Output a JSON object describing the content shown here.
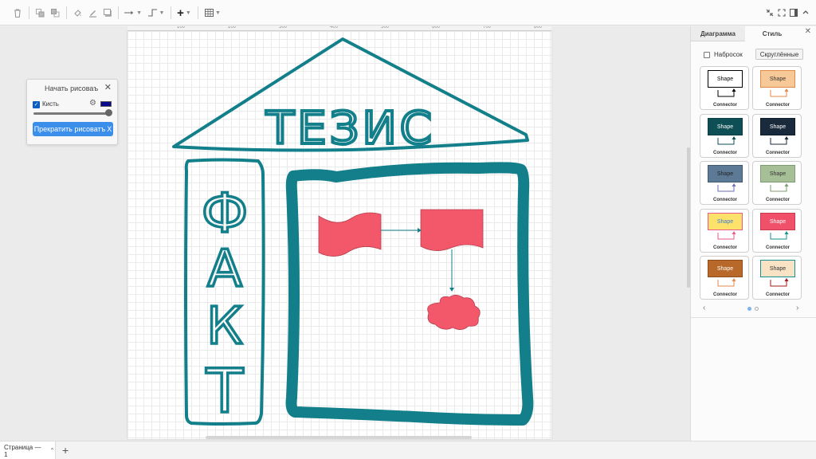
{
  "toolbar": {
    "icons": [
      "delete-icon",
      "to-front-icon",
      "to-back-icon",
      "fill-color-icon",
      "line-color-icon",
      "shadow-icon",
      "connection-icon",
      "waypoints-icon",
      "insert-icon",
      "table-icon",
      "fullscreen-icon",
      "collapse-icon",
      "format-panel-icon",
      "expand-icon"
    ]
  },
  "ruler": [
    "100",
    "200",
    "300",
    "400",
    "500",
    "600",
    "700",
    "800"
  ],
  "freehand": {
    "title": "Начать рисоваъ",
    "close": "✕",
    "brush_label": "Кисть",
    "brush_color": "#0a0a8c",
    "stop_label": "Прекратить рисоватъ",
    "stop_x": "X"
  },
  "drawing": {
    "roof_text": "ТЕЗИС",
    "pillar_text": [
      "Ф",
      "А",
      "К",
      "Т"
    ],
    "stroke_color": "#127f8a",
    "shape_fill": "#f2576a"
  },
  "statusbar": {
    "page_label": "Страница — 1",
    "page_caret": "⌃",
    "add_page": "+"
  },
  "sidebar": {
    "tabs": [
      "Диаграмма",
      "Стиль"
    ],
    "close": "✕",
    "sketch_label": "Набросок",
    "rounded_label": "Скруглённые",
    "styles": [
      {
        "shape": "Shape",
        "connector": "Connector",
        "fill": "#ffffff",
        "stroke": "#000000",
        "text": "#000000",
        "line": "#000000"
      },
      {
        "shape": "Shape",
        "connector": "Connector",
        "fill": "#f7c998",
        "stroke": "#e28a4a",
        "text": "#333333",
        "line": "#e28a4a"
      },
      {
        "shape": "Shape",
        "connector": "Connector",
        "fill": "#0d4f55",
        "stroke": "#0b3d42",
        "text": "#ffffff",
        "line": "#0d4f55"
      },
      {
        "shape": "Shape",
        "connector": "Connector",
        "fill": "#192a3d",
        "stroke": "#0f1a28",
        "text": "#ffffff",
        "line": "#192a3d"
      },
      {
        "shape": "Shape",
        "connector": "Connector",
        "fill": "#5c7a96",
        "stroke": "#40576d",
        "text": "#222222",
        "line": "#6a6fb8"
      },
      {
        "shape": "Shape",
        "connector": "Connector",
        "fill": "#a6bf97",
        "stroke": "#7d9a70",
        "text": "#333333",
        "line": "#7d9a70"
      },
      {
        "shape": "Shape",
        "connector": "Connector",
        "fill": "#fce26b",
        "stroke": "#e75a8c",
        "text": "#3b7ad6",
        "line": "#e75a8c"
      },
      {
        "shape": "Shape",
        "connector": "Connector",
        "fill": "#f0506a",
        "stroke": "#c8384f",
        "text": "#ffffff",
        "line": "#1a8f8f"
      },
      {
        "shape": "Shape",
        "connector": "Connector",
        "fill": "#b8692a",
        "stroke": "#8d4d1c",
        "text": "#ffffff",
        "line": "#e28a4a"
      },
      {
        "shape": "Shape",
        "connector": "Connector",
        "fill": "#fae3c5",
        "stroke": "#1a8f8f",
        "text": "#333333",
        "line": "#a31a1a"
      }
    ],
    "pager_prev": "‹",
    "pager_next": "›"
  }
}
